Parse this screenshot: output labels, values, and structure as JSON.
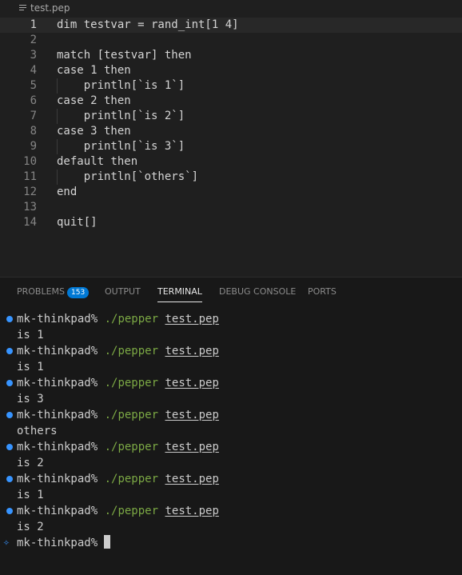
{
  "breadcrumb": {
    "file": "test.pep"
  },
  "editor": {
    "lines": [
      {
        "n": "1",
        "text": "dim testvar = rand_int[1 4]"
      },
      {
        "n": "2",
        "text": ""
      },
      {
        "n": "3",
        "text": "match [testvar] then"
      },
      {
        "n": "4",
        "text": "case 1 then"
      },
      {
        "n": "5",
        "text": "    println[`is 1`]"
      },
      {
        "n": "6",
        "text": "case 2 then"
      },
      {
        "n": "7",
        "text": "    println[`is 2`]"
      },
      {
        "n": "8",
        "text": "case 3 then"
      },
      {
        "n": "9",
        "text": "    println[`is 3`]"
      },
      {
        "n": "10",
        "text": "default then"
      },
      {
        "n": "11",
        "text": "    println[`others`]"
      },
      {
        "n": "12",
        "text": "end"
      },
      {
        "n": "13",
        "text": ""
      },
      {
        "n": "14",
        "text": "quit[]"
      }
    ]
  },
  "panel": {
    "tabs": {
      "problems": "PROBLEMS",
      "problems_count": "153",
      "output": "OUTPUT",
      "terminal": "TERMINAL",
      "debug_console": "DEBUG CONSOLE",
      "ports": "PORTS"
    },
    "active_tab": "TERMINAL"
  },
  "terminal": {
    "prompt_host": "mk-thinkpad%",
    "command": "./pepper",
    "argument": "test.pep",
    "runs": [
      {
        "output": "is 1"
      },
      {
        "output": "is 1"
      },
      {
        "output": "is 3"
      },
      {
        "output": "others"
      },
      {
        "output": "is 2"
      },
      {
        "output": "is 1"
      },
      {
        "output": "is 2"
      }
    ],
    "final_prompt": "mk-thinkpad%"
  },
  "colors": {
    "background": "#1f1f1f",
    "command_green": "#7ba844",
    "decoration_blue": "#3794ff",
    "badge_blue": "#0078d4"
  },
  "icons": {
    "breadcrumb": "file-lines-icon",
    "command_decoration": "circle-dot-icon",
    "final_prompt_decoration": "sparkle-icon"
  }
}
